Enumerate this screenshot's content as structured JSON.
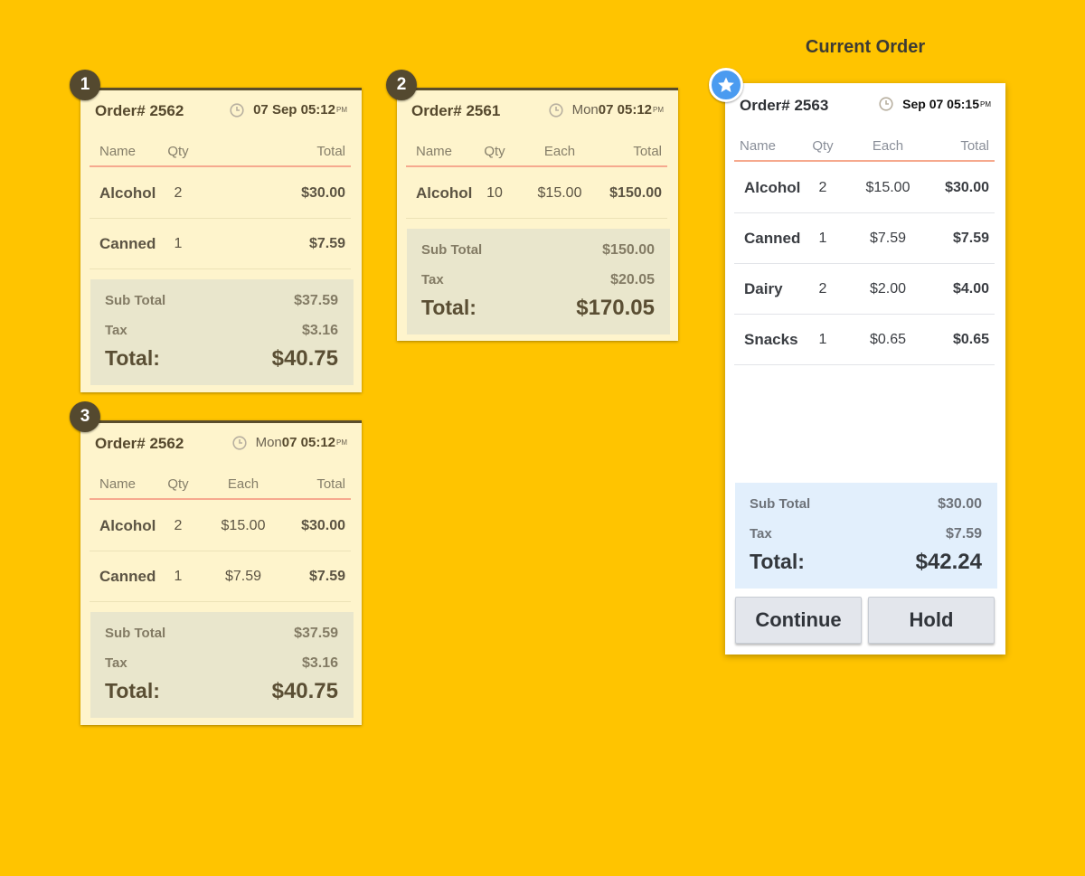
{
  "section_title": "Current Order",
  "columns": {
    "name": "Name",
    "qty": "Qty",
    "each": "Each",
    "total": "Total"
  },
  "labels": {
    "subtotal": "Sub Total",
    "tax": "Tax",
    "total": "Total:"
  },
  "tickets": [
    {
      "badge": "1",
      "order": "Order# 2562",
      "date_pre": "",
      "date_bold": "07 Sep 05:12",
      "ampm": "PM",
      "items": [
        {
          "name": "Alcohol",
          "qty": "2",
          "each": "",
          "total": "$30.00"
        },
        {
          "name": "Canned",
          "qty": "1",
          "each": "",
          "total": "$7.59"
        }
      ],
      "subtotal": "$37.59",
      "tax": "$3.16",
      "total": "$40.75"
    },
    {
      "badge": "2",
      "order": "Order# 2561",
      "date_pre": "Mon ",
      "date_bold": "07 05:12",
      "ampm": "PM",
      "items": [
        {
          "name": "Alcohol",
          "qty": "10",
          "each": "$15.00",
          "total": "$150.00"
        }
      ],
      "subtotal": "$150.00",
      "tax": "$20.05",
      "total": "$170.05"
    },
    {
      "badge": "3",
      "order": "Order# 2562",
      "date_pre": "Mon ",
      "date_bold": "07 05:12",
      "ampm": "PM",
      "items": [
        {
          "name": "Alcohol",
          "qty": "2",
          "each": "$15.00",
          "total": "$30.00"
        },
        {
          "name": "Canned",
          "qty": "1",
          "each": "$7.59",
          "total": "$7.59"
        }
      ],
      "subtotal": "$37.59",
      "tax": "$3.16",
      "total": "$40.75"
    }
  ],
  "current": {
    "order": "Order# 2563",
    "date_pre": "",
    "date_bold": "Sep 07 05:15",
    "ampm": "PM",
    "items": [
      {
        "name": "Alcohol",
        "qty": "2",
        "each": "$15.00",
        "total": "$30.00"
      },
      {
        "name": "Canned",
        "qty": "1",
        "each": "$7.59",
        "total": "$7.59"
      },
      {
        "name": "Dairy",
        "qty": "2",
        "each": "$2.00",
        "total": "$4.00"
      },
      {
        "name": "Snacks",
        "qty": "1",
        "each": "$0.65",
        "total": "$0.65"
      }
    ],
    "subtotal": "$30.00",
    "tax": "$7.59",
    "total": "$42.24",
    "continue_label": "Continue",
    "hold_label": "Hold"
  },
  "colors": {
    "background": "#FFC400",
    "ticket": "#FEF4CC",
    "star_badge": "#4A9BF0",
    "summary_current": "#E2EFFC"
  },
  "icons": {
    "badge_current": "star-icon",
    "timestamp": "clock-icon"
  }
}
